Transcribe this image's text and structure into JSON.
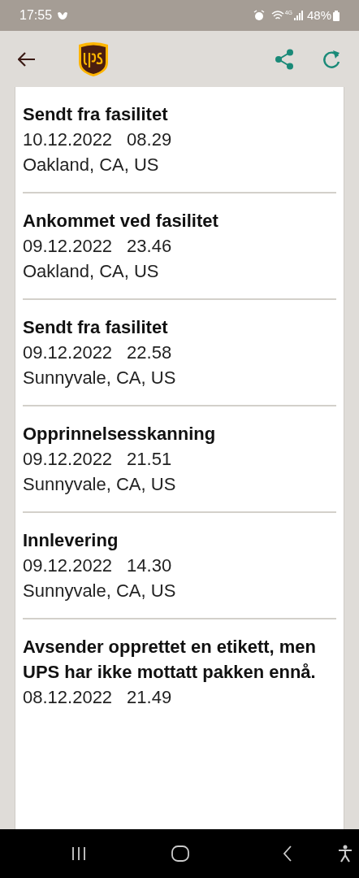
{
  "status_bar": {
    "time": "17:55",
    "network": "4G",
    "battery": "48%"
  },
  "events": [
    {
      "title": "Sendt fra fasilitet",
      "date": "10.12.2022",
      "time": "08.29",
      "location": "Oakland, CA, US"
    },
    {
      "title": "Ankommet ved fasilitet",
      "date": "09.12.2022",
      "time": "23.46",
      "location": "Oakland, CA, US"
    },
    {
      "title": "Sendt fra fasilitet",
      "date": "09.12.2022",
      "time": "22.58",
      "location": "Sunnyvale, CA, US"
    },
    {
      "title": "Opprinnelsesskanning",
      "date": "09.12.2022",
      "time": "21.51",
      "location": "Sunnyvale, CA, US"
    },
    {
      "title": "Innlevering",
      "date": "09.12.2022",
      "time": "14.30",
      "location": "Sunnyvale, CA, US"
    },
    {
      "title": "Avsender opprettet en etikett, men UPS har ikke mottatt pakken ennå.",
      "date": "08.12.2022",
      "time": "21.49"
    }
  ]
}
